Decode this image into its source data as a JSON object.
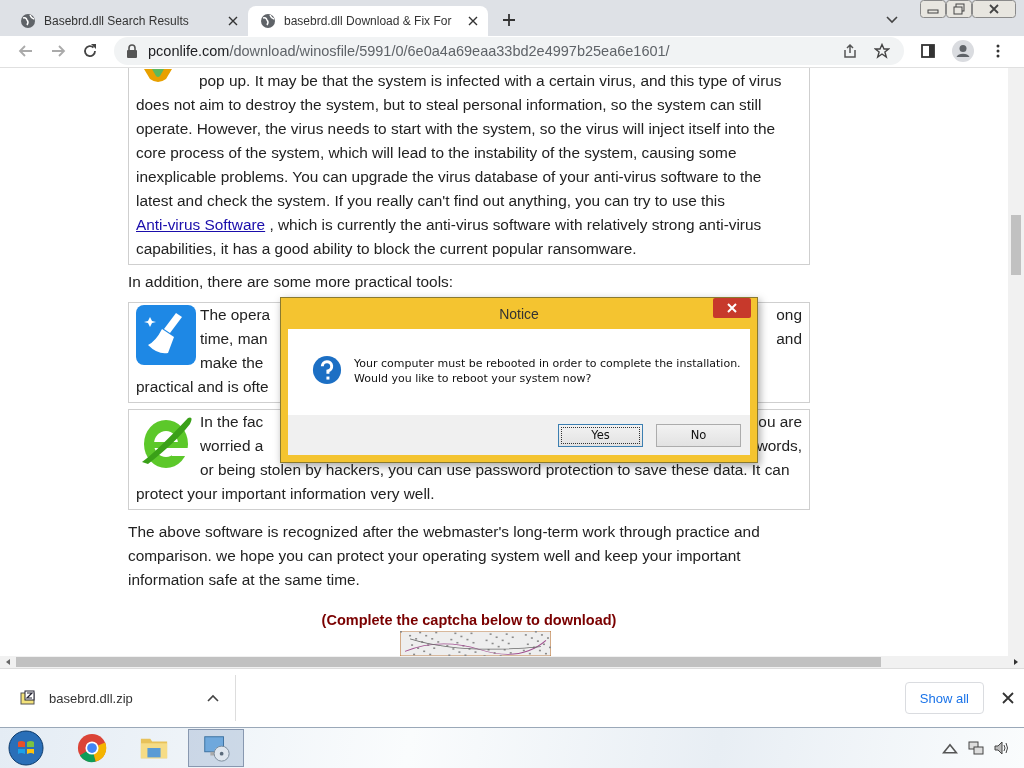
{
  "tabs": [
    {
      "title": "Basebrd.dll Search Results",
      "selected": false
    },
    {
      "title": "basebrd.dll Download & Fix For",
      "selected": true
    }
  ],
  "address_bar": {
    "url_host": "pconlife.com",
    "url_path": "/download/winosfile/5991/0/6e0a4a69eaa33bd2e4997b25ea6e1601/"
  },
  "article": {
    "intro_card": {
      "first_line": "pop up. It may be that the system is infected with a certain virus, and this type of virus",
      "text_before_link": "does not aim to destroy the system, but to steal personal information, so the system can still operate. However, the virus needs to start with the system, so the virus will inject itself into the core process of the system, which will lead to the instability of the system, causing some inexplicable problems. You can upgrade the virus database of your anti-virus software to the latest and check the system. If you really can't find out anything, you can try to use this",
      "link": "Anti-virus Software",
      "text_after_link": ", which is currently the anti-virus software with relatively strong anti-virus capabilities, it has a good ability to block the current popular ransomware."
    },
    "tools_heading": "In addition, there are some more practical tools:",
    "tool_cards": [
      {
        "kind": "broom",
        "beside": [
          {
            "left": "The opera",
            "right": "ong"
          },
          {
            "left": "time, man",
            "right": "and"
          },
          {
            "left": "make the"
          }
        ],
        "below": [
          {
            "left": "practical and is ofte"
          }
        ]
      },
      {
        "kind": "globe",
        "beside": [
          {
            "left": "In the fac",
            "right": "ou are"
          },
          {
            "left": "worried a",
            "right": "words,"
          },
          {
            "left": "or being stolen by hackers, you can use password protection to save these data. It can"
          }
        ],
        "below": [
          {
            "left": "protect your important information very well."
          }
        ]
      }
    ],
    "closing": "The above software is recognized after the webmaster's long-term work through practice and comparison. we hope you can protect your operating system well and keep your important information safe at the same time.",
    "captcha_prompt": "(Complete the captcha below to download)"
  },
  "dialog": {
    "title": "Notice",
    "message_lines": [
      "Your computer must be rebooted in order to complete the installation.",
      "Would you like to reboot your system now?"
    ],
    "buttons": [
      {
        "label": "Yes",
        "focused": true
      },
      {
        "label": "No",
        "focused": false
      }
    ]
  },
  "download_bar": {
    "file": "basebrd.dll.zip",
    "show_all": "Show all"
  },
  "taskbar": {
    "apps": [
      {
        "kind": "chrome",
        "selected": false
      },
      {
        "kind": "folder",
        "selected": false
      },
      {
        "kind": "disc",
        "selected": true
      }
    ]
  }
}
